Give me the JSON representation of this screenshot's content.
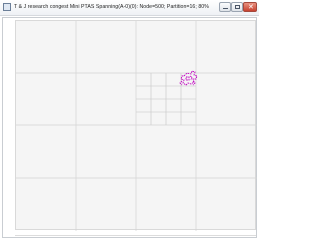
{
  "window": {
    "title": "T & J research   congest Mini PTAS Spanning(A-0)(0): Node=500; Partition=16;  80%",
    "buttons": {
      "minimize_icon": "minimize-icon",
      "maximize_icon": "maximize-icon",
      "close_icon": "close-icon",
      "close_glyph": "✕"
    }
  },
  "colors": {
    "background": "#f5f5f5",
    "grid_major": "#d3d3d3",
    "grid_minor": "#c4c4c4",
    "partition_path": "#c000c0",
    "close_button": "#c7412f"
  }
}
